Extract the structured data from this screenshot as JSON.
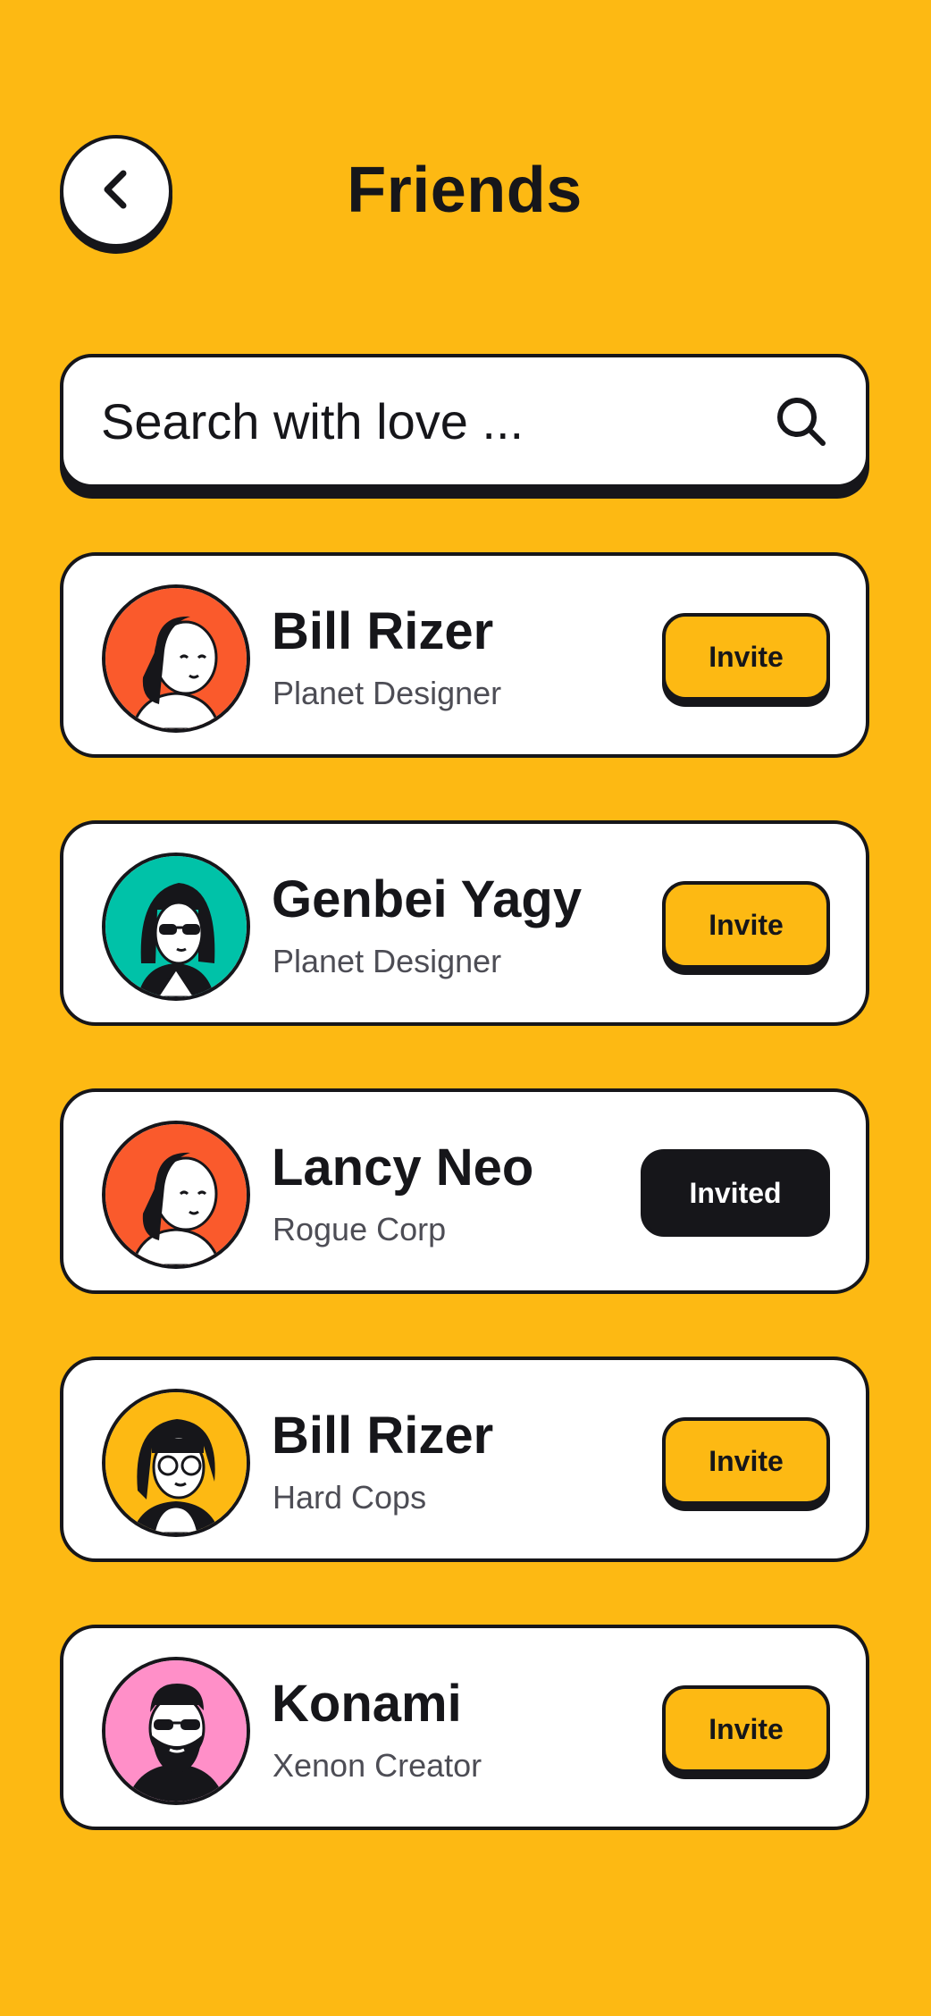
{
  "header": {
    "title": "Friends",
    "back_icon": "chevron-left-icon"
  },
  "search": {
    "placeholder": "Search with love ...",
    "icon": "search-icon"
  },
  "friends": [
    {
      "name": "Bill Rizer",
      "role": "Planet Designer",
      "action": "Invite",
      "state": "invite",
      "avatar_bg": "#FA5A2C",
      "avatar_icon": "woman-braid-avatar-icon"
    },
    {
      "name": "Genbei Yagy",
      "role": "Planet Designer",
      "action": "Invite",
      "state": "invite",
      "avatar_bg": "#00C2A8",
      "avatar_icon": "sunglasses-woman-avatar-icon"
    },
    {
      "name": "Lancy Neo",
      "role": "Rogue Corp",
      "action": "Invited",
      "state": "invited",
      "avatar_bg": "#FA5A2C",
      "avatar_icon": "woman-braid-avatar-icon"
    },
    {
      "name": "Bill Rizer",
      "role": "Hard Cops",
      "action": "Invite",
      "state": "invite",
      "avatar_bg": "#FDB913",
      "avatar_icon": "glasses-woman-avatar-icon"
    },
    {
      "name": "Konami",
      "role": "Xenon Creator",
      "action": "Invite",
      "state": "invite",
      "avatar_bg": "#FF8FC8",
      "avatar_icon": "bearded-man-avatar-icon"
    }
  ],
  "colors": {
    "background": "#FDB913",
    "ink": "#16161a",
    "card": "#FFFFFF",
    "muted_text": "#4d4d55"
  }
}
